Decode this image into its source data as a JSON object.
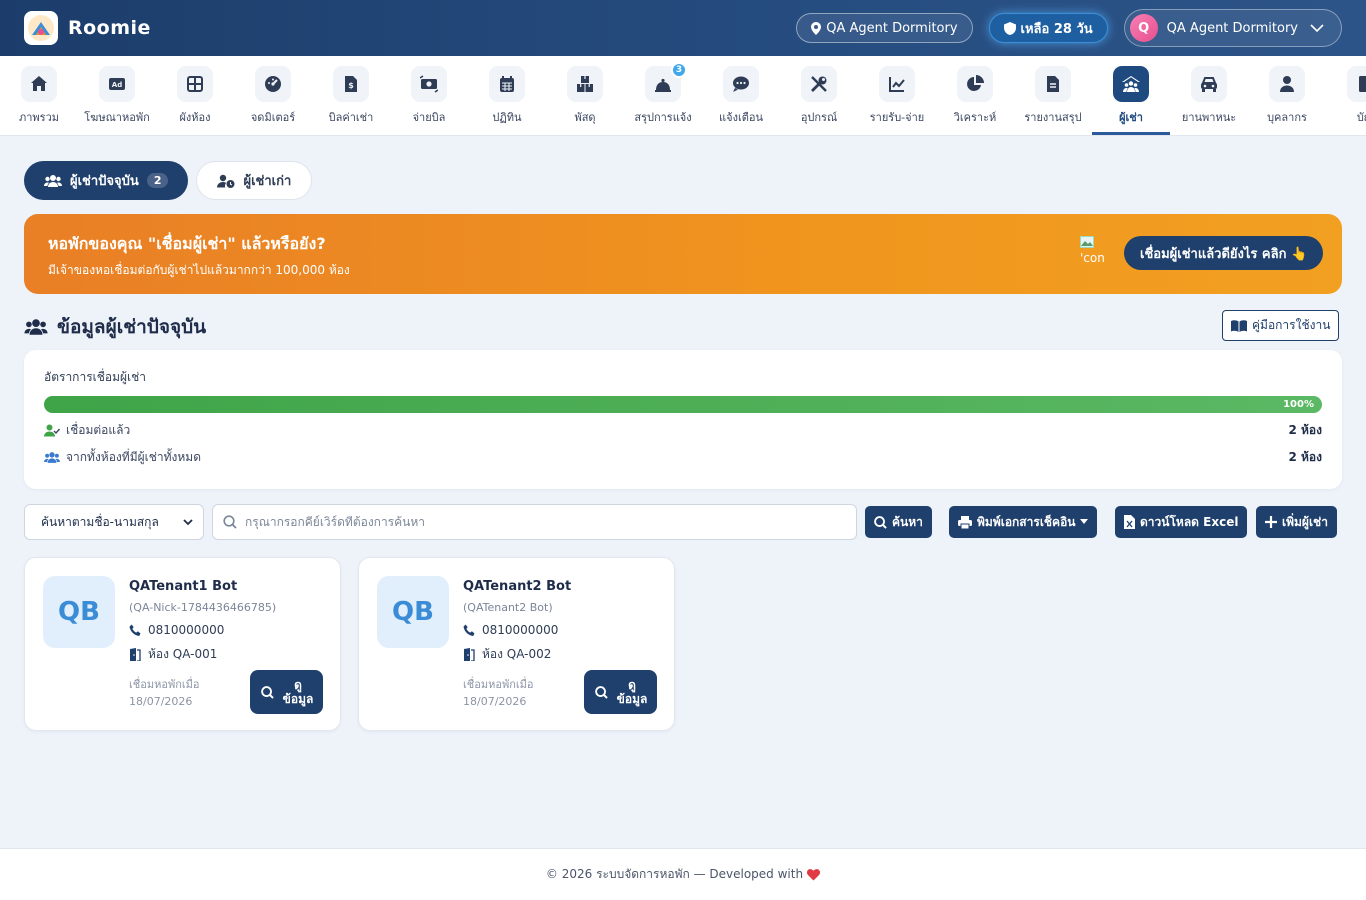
{
  "header": {
    "brand": "Roomie",
    "dorm_label": "QA Agent Dormitory",
    "trial_label": "เหลือ 28 วัน",
    "user_initial": "Q",
    "user_name": "QA Agent Dormitory"
  },
  "nav": {
    "items": [
      {
        "label": "ภาพรวม",
        "icon": "home-icon"
      },
      {
        "label": "โฆษณาหอพัก",
        "icon": "ad-icon"
      },
      {
        "label": "ผังห้อง",
        "icon": "grid-icon"
      },
      {
        "label": "จดมิเตอร์",
        "icon": "gauge-icon"
      },
      {
        "label": "บิลค่าเช่า",
        "icon": "invoice-icon"
      },
      {
        "label": "จ่ายบิล",
        "icon": "money-icon"
      },
      {
        "label": "ปฏิทิน",
        "icon": "calendar-icon"
      },
      {
        "label": "พัสดุ",
        "icon": "boxes-icon"
      },
      {
        "label": "สรุปการแจ้ง",
        "icon": "bell-icon",
        "badge": "3"
      },
      {
        "label": "แจ้งเตือน",
        "icon": "chat-icon"
      },
      {
        "label": "อุปกรณ์",
        "icon": "tools-icon"
      },
      {
        "label": "รายรับ-จ่าย",
        "icon": "line-chart-icon"
      },
      {
        "label": "วิเคราะห์",
        "icon": "pie-chart-icon"
      },
      {
        "label": "รายงานสรุป",
        "icon": "file-icon"
      },
      {
        "label": "ผู้เช่า",
        "icon": "tenant-icon",
        "active": true
      },
      {
        "label": "ยานพาหนะ",
        "icon": "car-icon"
      },
      {
        "label": "บุคลากร",
        "icon": "person-icon"
      },
      {
        "label": "บัญ",
        "icon": "book-icon"
      }
    ]
  },
  "tabs": {
    "current_label": "ผู้เช่าปัจจุบัน",
    "current_count": "2",
    "former_label": "ผู้เช่าเก่า"
  },
  "banner": {
    "title": "หอพักของคุณ \"เชื่อมผู้เช่า\" แล้วหรือยัง?",
    "subtitle": "มีเจ้าของหอเชื่อมต่อกับผู้เช่าไปแล้วมากกว่า 100,000 ห้อง",
    "broken_img_text": "'con",
    "button_label": "เชื่อมผู้เช่าแล้วดียังไร คลิก 👆"
  },
  "section": {
    "title": "ข้อมูลผู้เช่าปัจจุบัน",
    "manual_label": "คู่มือการใช้งาน"
  },
  "stats": {
    "title": "อัตราการเชื่อมผู้เช่า",
    "progress_percent": 100,
    "progress_label": "100%",
    "connected_label": "เชื่อมต่อแล้ว",
    "connected_value": "2 ห้อง",
    "total_label": "จากทั้งห้องที่มีผู้เช่าทั้งหมด",
    "total_value": "2 ห้อง"
  },
  "toolbar": {
    "search_by": "ค้นหาตามชื่อ-นามสกุล",
    "search_placeholder": "กรุณากรอกคีย์เวิร์ดที่ต้องการค้นหา",
    "search_label": "ค้นหา",
    "print_label": "พิมพ์เอกสารเช็คอิน",
    "excel_label": "ดาวน์โหลด Excel",
    "add_label": "เพิ่มผู้เช่า"
  },
  "tenants": [
    {
      "initials": "QB",
      "name": "QATenant1 Bot",
      "nick": "(QA-Nick-1784436466785)",
      "phone": "0810000000",
      "room": "ห้อง QA-001",
      "joined_label": "เชื่อมหอพักเมื่อ",
      "joined_date": "18/07/2026",
      "view_label": "ดูข้อมูล"
    },
    {
      "initials": "QB",
      "name": "QATenant2 Bot",
      "nick": "(QATenant2 Bot)",
      "phone": "0810000000",
      "room": "ห้อง QA-002",
      "joined_label": "เชื่อมหอพักเมื่อ",
      "joined_date": "18/07/2026",
      "view_label": "ดูข้อมูล"
    }
  ],
  "footer": {
    "text": "© 2026 ระบบจัดการหอพัก — Developed with"
  },
  "colors": {
    "primary": "#1f3f6c",
    "banner_orange": "#f0951e",
    "progress_green": "#4caf50",
    "heart": "#e03a45"
  }
}
